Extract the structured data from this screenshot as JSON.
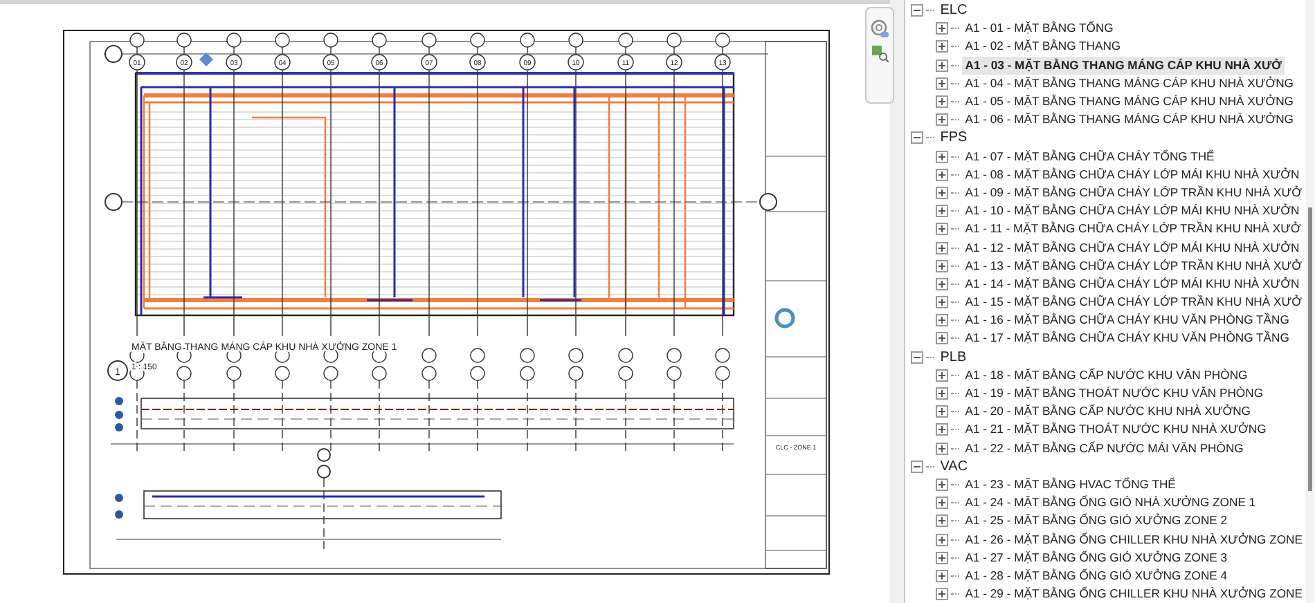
{
  "drawing": {
    "view_number": "1",
    "view_title": "MẶT BẰNG THANG MÁNG CÁP KHU NHÀ XƯỞNG ZONE 1",
    "view_scale": "1 : 150",
    "grid_labels": [
      "01",
      "02",
      "03",
      "04",
      "05",
      "06",
      "07",
      "08",
      "09",
      "10",
      "11",
      "12",
      "13"
    ],
    "sheet_number": "CLC - ZONE 1"
  },
  "browser": {
    "groups": [
      {
        "label": "ELC",
        "expanded": true,
        "children": [
          {
            "label": "A1 - 01 - MẶT BẰNG TỔNG",
            "expanded": false,
            "selected": false
          },
          {
            "label": "A1 - 02 - MẶT BẰNG THANG",
            "expanded": false,
            "selected": false
          },
          {
            "label": "A1 - 03 - MẶT BẰNG THANG MÁNG CÁP KHU NHÀ XƯỞ",
            "expanded": false,
            "selected": true
          },
          {
            "label": "A1 - 04 - MẶT BẰNG THANG MÁNG CÁP KHU NHÀ XƯỞNG",
            "expanded": false,
            "selected": false
          },
          {
            "label": "A1 - 05 - MẶT BẰNG THANG MÁNG CÁP KHU NHÀ XƯỞNG",
            "expanded": false,
            "selected": false
          },
          {
            "label": "A1 - 06 - MẶT BẰNG THANG MÁNG CÁP KHU NHÀ XƯỞNG",
            "expanded": false,
            "selected": false
          }
        ]
      },
      {
        "label": "FPS",
        "expanded": true,
        "children": [
          {
            "label": "A1 - 07 - MẶT BẰNG CHỮA CHÁY TỔNG THỂ",
            "expanded": false,
            "selected": false
          },
          {
            "label": "A1 - 08 - MẶT BẰNG CHỮA CHÁY LỚP MÁI KHU NHÀ XƯỞN",
            "expanded": false,
            "selected": false
          },
          {
            "label": "A1 - 09 - MẶT BẰNG CHỮA CHÁY LỚP TRẦN KHU NHÀ XƯỞ",
            "expanded": false,
            "selected": false
          },
          {
            "label": "A1 - 10 - MẶT BẰNG CHỮA CHÁY LỚP MÁI KHU NHÀ XƯỞN",
            "expanded": false,
            "selected": false
          },
          {
            "label": "A1 - 11 - MẶT BẰNG CHỮA CHÁY LỚP TRẦN KHU NHÀ XƯỞ",
            "expanded": false,
            "selected": false
          },
          {
            "label": "A1 - 12 - MẶT BẰNG CHỮA CHÁY LỚP MÁI KHU NHÀ XƯỞN",
            "expanded": false,
            "selected": false
          },
          {
            "label": "A1 - 13 - MẶT BẰNG CHỮA CHÁY LỚP TRẦN KHU NHÀ XƯỞ",
            "expanded": false,
            "selected": false
          },
          {
            "label": "A1 - 14 - MẶT BẰNG CHỮA CHÁY LỚP MÁI KHU NHÀ XƯỞN",
            "expanded": false,
            "selected": false
          },
          {
            "label": "A1 - 15 - MẶT BẰNG CHỮA CHÁY LỚP TRẦN KHU NHÀ XƯỞ",
            "expanded": false,
            "selected": false
          },
          {
            "label": "A1 - 16 - MẶT BẰNG CHỮA CHÁY KHU VĂN PHÒNG TẦNG",
            "expanded": false,
            "selected": false
          },
          {
            "label": "A1 - 17 - MẶT BẰNG CHỮA CHÁY KHU VĂN PHÒNG TẦNG",
            "expanded": false,
            "selected": false
          }
        ]
      },
      {
        "label": "PLB",
        "expanded": true,
        "children": [
          {
            "label": "A1 - 18 - MẶT BẰNG CẤP NƯỚC KHU VĂN PHÒNG",
            "expanded": false,
            "selected": false
          },
          {
            "label": "A1 - 19 - MẶT BẰNG THOÁT NƯỚC KHU VĂN PHÒNG",
            "expanded": false,
            "selected": false
          },
          {
            "label": "A1 - 20 - MẶT BẰNG CẤP NƯỚC KHU NHÀ XƯỞNG",
            "expanded": false,
            "selected": false
          },
          {
            "label": "A1 - 21 - MẶT BẰNG THOÁT NƯỚC KHU NHÀ XƯỞNG",
            "expanded": false,
            "selected": false
          },
          {
            "label": "A1 - 22 - MẶT BẰNG CẤP NƯỚC MÁI VĂN PHÒNG",
            "expanded": false,
            "selected": false
          }
        ]
      },
      {
        "label": "VAC",
        "expanded": true,
        "children": [
          {
            "label": "A1 - 23 - MẶT BẰNG HVAC TỔNG THỂ",
            "expanded": false,
            "selected": false
          },
          {
            "label": "A1 - 24 - MẶT BẰNG ỐNG GIÓ NHÀ XƯỞNG ZONE 1",
            "expanded": false,
            "selected": false
          },
          {
            "label": "A1 - 25 - MẶT BẰNG ỐNG GIÓ XƯỞNG ZONE 2",
            "expanded": false,
            "selected": false
          },
          {
            "label": "A1 - 26 - MẶT BẰNG ỐNG CHILLER KHU NHÀ XƯỞNG ZONE",
            "expanded": false,
            "selected": false
          },
          {
            "label": "A1 - 27 - MẶT BẰNG ỐNG GIÓ XƯỞNG ZONE 3",
            "expanded": false,
            "selected": false
          },
          {
            "label": "A1 - 28 - MẶT BẰNG ỐNG GIÓ XƯỞNG ZONE 4",
            "expanded": false,
            "selected": false
          },
          {
            "label": "A1 - 29 - MẶT BẰNG ỐNG CHILLER KHU NHÀ XƯỞNG ZONE",
            "expanded": false,
            "selected": false
          }
        ]
      }
    ]
  }
}
